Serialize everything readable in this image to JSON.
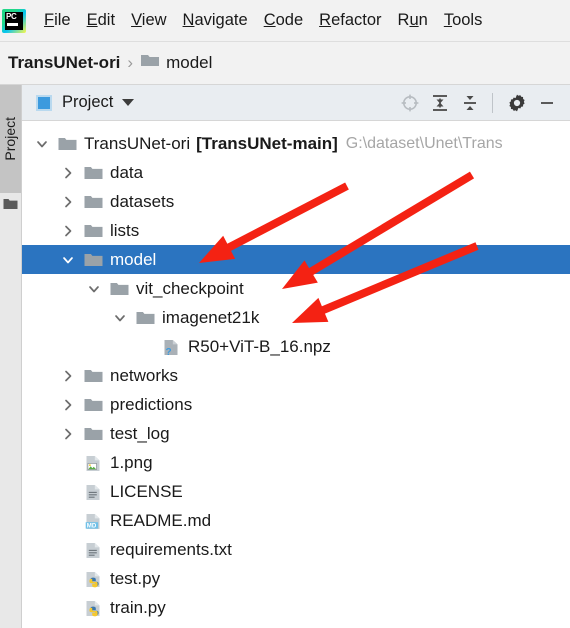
{
  "app": {
    "logo": "pycharm-logo",
    "logo_text": "PC"
  },
  "menubar": {
    "items": [
      {
        "label": "File",
        "mnemonic": "F"
      },
      {
        "label": "Edit",
        "mnemonic": "E"
      },
      {
        "label": "View",
        "mnemonic": "V"
      },
      {
        "label": "Navigate",
        "mnemonic": "N"
      },
      {
        "label": "Code",
        "mnemonic": "C"
      },
      {
        "label": "Refactor",
        "mnemonic": "R"
      },
      {
        "label": "Run",
        "mnemonic": "u"
      },
      {
        "label": "Tools",
        "mnemonic": "T"
      }
    ]
  },
  "breadcrumb": {
    "root": "TransUNet-ori",
    "separator": "›",
    "leaf": "model",
    "leaf_icon": "folder-icon"
  },
  "side_strip": {
    "tab_label": "Project",
    "tab_icon": "project-folder-icon"
  },
  "tool_window": {
    "title": "Project",
    "window_icon": "project-window-icon",
    "dropdown_icon": "chevron-down-icon",
    "actions": [
      {
        "name": "locate-icon",
        "label": "Select Opened File"
      },
      {
        "name": "expand-all-icon",
        "label": "Expand All"
      },
      {
        "name": "collapse-all-icon",
        "label": "Collapse All"
      },
      {
        "name": "gear-icon",
        "label": "Options"
      },
      {
        "name": "minimize-icon",
        "label": "Hide"
      }
    ]
  },
  "tree": {
    "rows": [
      {
        "name": "TransUNet-ori",
        "module": "[TransUNet-main]",
        "path": "G:\\dataset\\Unet\\Trans",
        "icon": "folder-icon",
        "state": "expanded",
        "depth": 0,
        "selected": false
      },
      {
        "name": "data",
        "icon": "folder-icon",
        "state": "collapsed",
        "depth": 1,
        "selected": false
      },
      {
        "name": "datasets",
        "icon": "folder-icon",
        "state": "collapsed",
        "depth": 1,
        "selected": false
      },
      {
        "name": "lists",
        "icon": "folder-icon",
        "state": "collapsed",
        "depth": 1,
        "selected": false
      },
      {
        "name": "model",
        "icon": "folder-icon",
        "state": "expanded",
        "depth": 1,
        "selected": true
      },
      {
        "name": "vit_checkpoint",
        "icon": "folder-icon",
        "state": "expanded",
        "depth": 2,
        "selected": false
      },
      {
        "name": "imagenet21k",
        "icon": "folder-icon",
        "state": "expanded",
        "depth": 3,
        "selected": false
      },
      {
        "name": "R50+ViT-B_16.npz",
        "icon": "unknown-file-icon",
        "state": "leaf",
        "depth": 4,
        "selected": false
      },
      {
        "name": "networks",
        "icon": "folder-icon",
        "state": "collapsed",
        "depth": 1,
        "selected": false
      },
      {
        "name": "predictions",
        "icon": "folder-icon",
        "state": "collapsed",
        "depth": 1,
        "selected": false
      },
      {
        "name": "test_log",
        "icon": "folder-icon",
        "state": "collapsed",
        "depth": 1,
        "selected": false
      },
      {
        "name": "1.png",
        "icon": "image-file-icon",
        "state": "leaf",
        "depth": 1,
        "selected": false
      },
      {
        "name": "LICENSE",
        "icon": "text-file-icon",
        "state": "leaf",
        "depth": 1,
        "selected": false
      },
      {
        "name": "README.md",
        "icon": "markdown-file-icon",
        "state": "leaf",
        "depth": 1,
        "selected": false
      },
      {
        "name": "requirements.txt",
        "icon": "text-file-icon",
        "state": "leaf",
        "depth": 1,
        "selected": false
      },
      {
        "name": "test.py",
        "icon": "python-file-icon",
        "state": "leaf",
        "depth": 1,
        "selected": false
      },
      {
        "name": "train.py",
        "icon": "python-file-icon",
        "state": "leaf",
        "depth": 1,
        "selected": false
      }
    ]
  },
  "annotations": {
    "arrow_color": "#f42213",
    "arrows": [
      {
        "name": "arrow-to-model",
        "target": "model"
      },
      {
        "name": "arrow-to-vit-checkpoint",
        "target": "vit_checkpoint"
      },
      {
        "name": "arrow-to-imagenet21k",
        "target": "imagenet21k"
      }
    ]
  },
  "colors": {
    "selection_blue": "#2b74c0",
    "folder_gray": "#9aa2a8",
    "toolbar_bg": "#e9edf1",
    "menubar_bg": "#f2f2f2"
  }
}
